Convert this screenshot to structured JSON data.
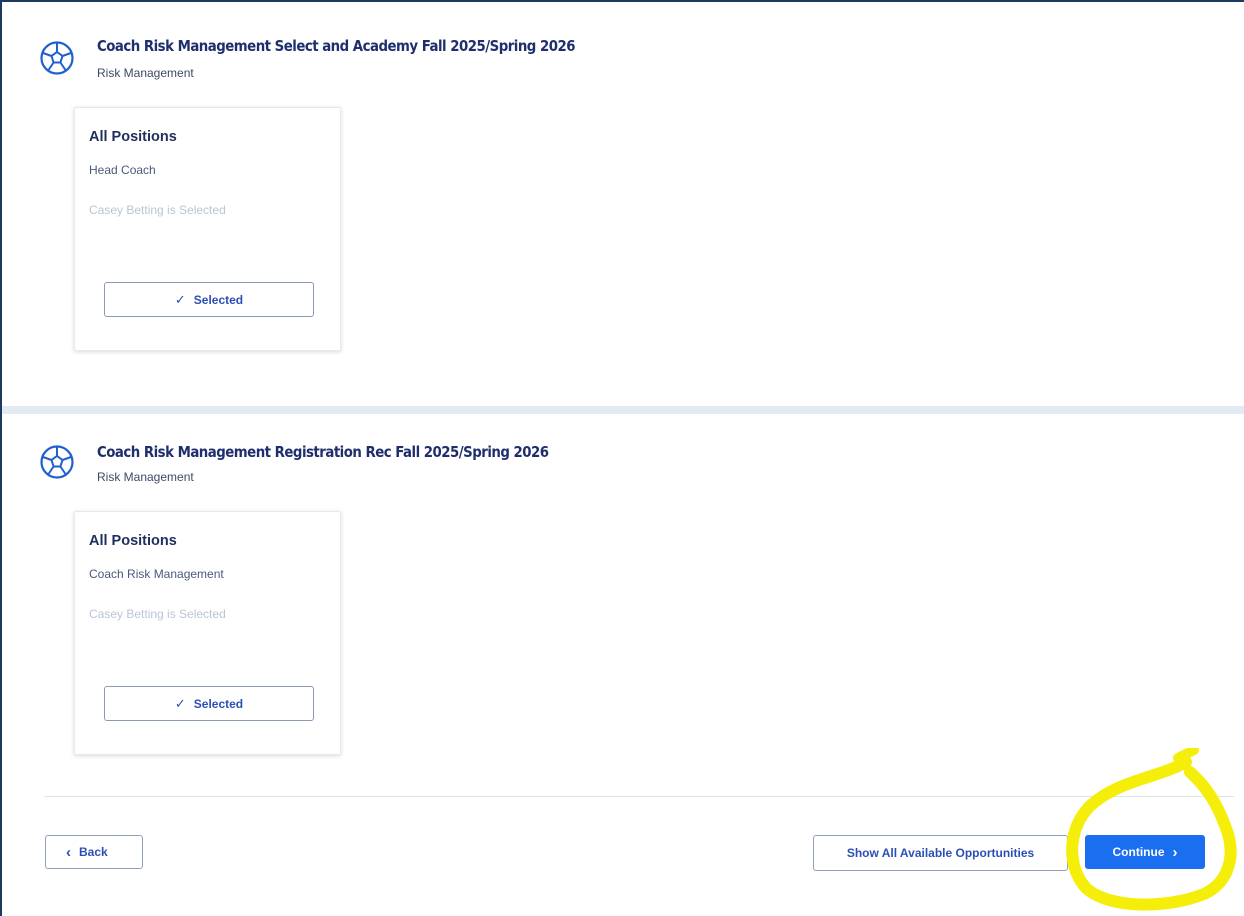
{
  "sections": [
    {
      "title": "Coach Risk Management Select and Academy Fall 2025/Spring 2026",
      "subtitle": "Risk Management",
      "card": {
        "title": "All Positions",
        "position": "Head Coach",
        "status": "Casey Betting is Selected",
        "button_label": "Selected"
      }
    },
    {
      "title": "Coach Risk Management Registration Rec Fall 2025/Spring 2026",
      "subtitle": "Risk Management",
      "card": {
        "title": "All Positions",
        "position": "Coach Risk Management",
        "status": "Casey Betting is Selected",
        "button_label": "Selected"
      }
    }
  ],
  "footer": {
    "back_label": "Back",
    "show_all_label": "Show All Available Opportunities",
    "continue_label": "Continue"
  },
  "icons": {
    "section_icon": "soccer-ball-icon",
    "check": "check-icon",
    "back": "chevron-left-icon",
    "continue": "chevron-right-icon"
  },
  "colors": {
    "primary": "#1a6ef0",
    "title": "#1f2f6e",
    "link_text": "#2c4fb5",
    "highlight": "#f5ee0a"
  }
}
